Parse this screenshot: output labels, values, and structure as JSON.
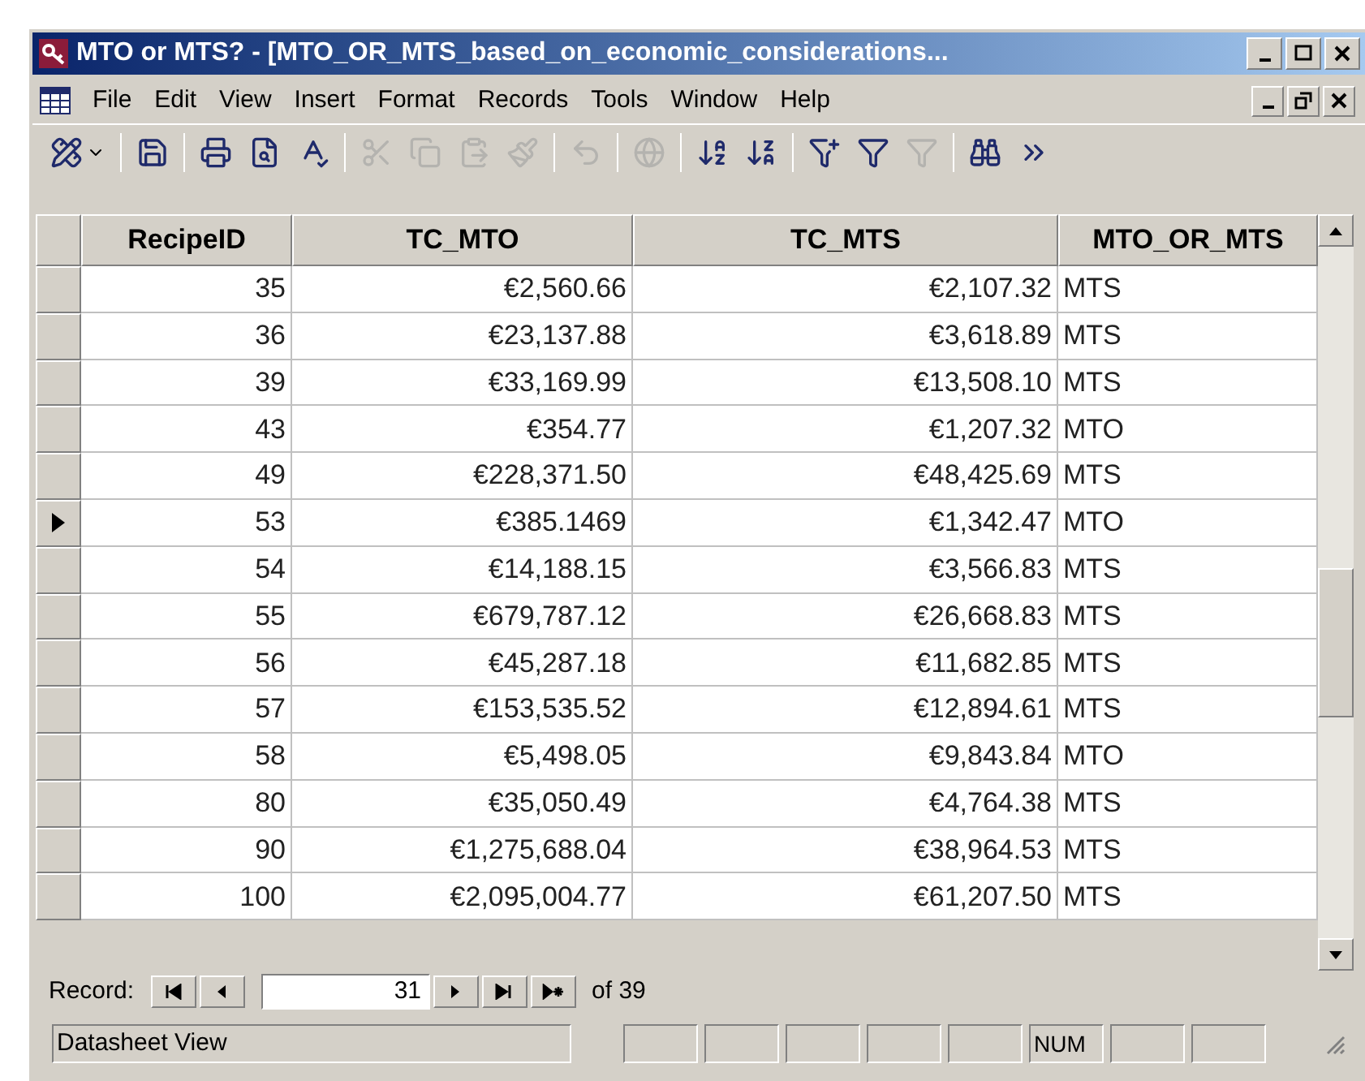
{
  "window": {
    "title": "MTO or MTS? - [MTO_OR_MTS_based_on_economic_considerations..."
  },
  "menu": [
    "File",
    "Edit",
    "View",
    "Insert",
    "Format",
    "Records",
    "Tools",
    "Window",
    "Help"
  ],
  "toolbar": [
    [
      {
        "kind": "design",
        "disabled": false
      }
    ],
    [
      {
        "kind": "save",
        "disabled": false
      }
    ],
    [
      {
        "kind": "print",
        "disabled": false
      },
      {
        "kind": "preview",
        "disabled": false
      },
      {
        "kind": "spelling",
        "disabled": false
      }
    ],
    [
      {
        "kind": "cut",
        "disabled": true
      },
      {
        "kind": "copy",
        "disabled": true
      },
      {
        "kind": "paste",
        "disabled": true
      },
      {
        "kind": "painter",
        "disabled": true
      }
    ],
    [
      {
        "kind": "undo",
        "disabled": true
      }
    ],
    [
      {
        "kind": "hyperlink",
        "disabled": true
      }
    ],
    [
      {
        "kind": "sort-asc",
        "disabled": false
      },
      {
        "kind": "sort-desc",
        "disabled": false
      }
    ],
    [
      {
        "kind": "filter-selection",
        "disabled": false
      },
      {
        "kind": "filter-form",
        "disabled": false
      },
      {
        "kind": "filter",
        "disabled": true
      }
    ],
    [
      {
        "kind": "find",
        "disabled": false
      },
      {
        "kind": "more",
        "disabled": false
      }
    ]
  ],
  "table": {
    "columns": [
      "RecipeID",
      "TC_MTO",
      "TC_MTS",
      "MTO_OR_MTS"
    ],
    "rows": [
      {
        "cells": [
          "35",
          "€2,560.66",
          "€2,107.32",
          "MTS"
        ],
        "current": false
      },
      {
        "cells": [
          "36",
          "€23,137.88",
          "€3,618.89",
          "MTS"
        ],
        "current": false
      },
      {
        "cells": [
          "39",
          "€33,169.99",
          "€13,508.10",
          "MTS"
        ],
        "current": false
      },
      {
        "cells": [
          "43",
          "€354.77",
          "€1,207.32",
          "MTO"
        ],
        "current": false
      },
      {
        "cells": [
          "49",
          "€228,371.50",
          "€48,425.69",
          "MTS"
        ],
        "current": false
      },
      {
        "cells": [
          "53",
          "€385.1469",
          "€1,342.47",
          "MTO"
        ],
        "current": true
      },
      {
        "cells": [
          "54",
          "€14,188.15",
          "€3,566.83",
          "MTS"
        ],
        "current": false
      },
      {
        "cells": [
          "55",
          "€679,787.12",
          "€26,668.83",
          "MTS"
        ],
        "current": false
      },
      {
        "cells": [
          "56",
          "€45,287.18",
          "€11,682.85",
          "MTS"
        ],
        "current": false
      },
      {
        "cells": [
          "57",
          "€153,535.52",
          "€12,894.61",
          "MTS"
        ],
        "current": false
      },
      {
        "cells": [
          "58",
          "€5,498.05",
          "€9,843.84",
          "MTO"
        ],
        "current": false
      },
      {
        "cells": [
          "80",
          "€35,050.49",
          "€4,764.38",
          "MTS"
        ],
        "current": false
      },
      {
        "cells": [
          "90",
          "€1,275,688.04",
          "€38,964.53",
          "MTS"
        ],
        "current": false
      },
      {
        "cells": [
          "100",
          "€2,095,004.77",
          "€61,207.50",
          "MTS"
        ],
        "current": false
      }
    ]
  },
  "record_nav": {
    "label": "Record:",
    "current": "31",
    "total": "of 39"
  },
  "status_bar": {
    "text": "Datasheet View",
    "indicator": "NUM"
  }
}
